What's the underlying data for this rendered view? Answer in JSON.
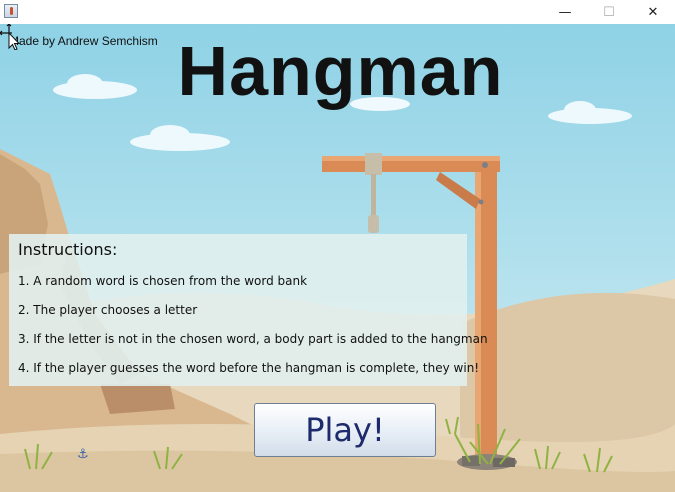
{
  "window": {
    "minimize_glyph": "—",
    "maximize_glyph": "☐",
    "close_glyph": "✕"
  },
  "credit": "Made by Andrew Semchism",
  "title": "Hangman",
  "instructions": {
    "heading": "Instructions:",
    "steps": [
      "1. A random word is chosen from the word bank",
      "2. The player chooses a letter",
      "3. If the letter is not in the chosen word, a body part is added to the hangman",
      "4. If the player guesses the word before the hangman is complete, they win!"
    ]
  },
  "play_button": {
    "label": "Play!"
  },
  "icons": [
    "app-icon",
    "minimize-icon",
    "maximize-icon",
    "close-icon",
    "move-cursor-icon",
    "anchor-icon"
  ],
  "colors": {
    "sky": "#a9dcea",
    "sand": "#e4d4ba",
    "wood": "#d98a55",
    "play_text": "#1d2a6b"
  }
}
